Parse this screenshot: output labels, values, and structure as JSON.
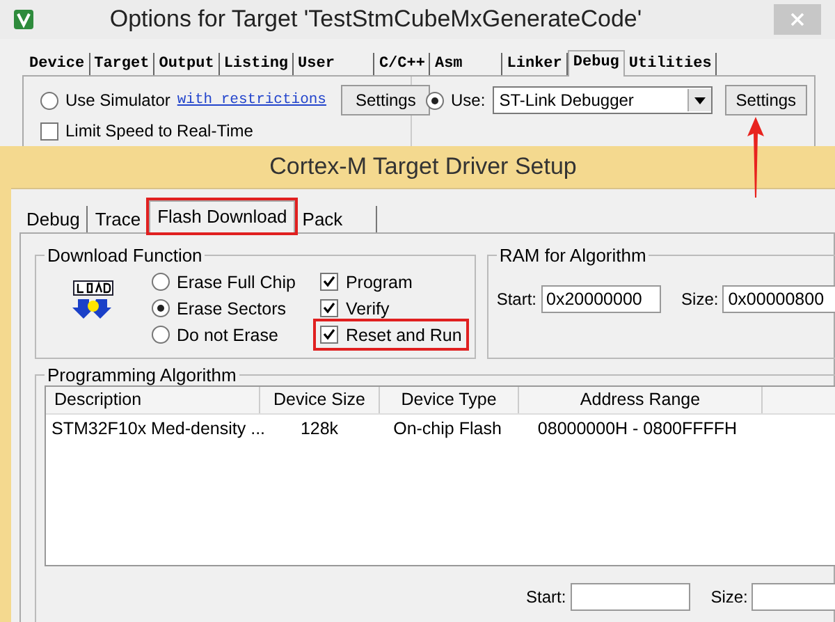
{
  "window": {
    "title": "Options for Target 'TestStmCubeMxGenerateCode'"
  },
  "tabs": [
    {
      "label": "Device",
      "selected": false
    },
    {
      "label": "Target",
      "selected": false
    },
    {
      "label": "Output",
      "selected": false
    },
    {
      "label": "Listing",
      "selected": false
    },
    {
      "label": "User",
      "selected": false
    },
    {
      "label": "C/C++",
      "selected": false
    },
    {
      "label": "Asm",
      "selected": false
    },
    {
      "label": "Linker",
      "selected": false
    },
    {
      "label": "Debug",
      "selected": true
    },
    {
      "label": "Utilities",
      "selected": false
    }
  ],
  "debug_panel": {
    "simulator": {
      "label": "Use Simulator",
      "selected": false
    },
    "restrictions_link": "with restrictions",
    "simulator_settings": "Settings",
    "limit_speed": {
      "label": "Limit Speed to Real-Time",
      "checked": false
    },
    "use": {
      "label": "Use:",
      "selected": true
    },
    "debugger": "ST-Link Debugger",
    "debugger_settings": "Settings"
  },
  "dialog": {
    "title": "Cortex-M Target Driver Setup",
    "tabs": [
      {
        "label": "Debug",
        "selected": false,
        "highlighted": false
      },
      {
        "label": "Trace",
        "selected": false,
        "highlighted": false
      },
      {
        "label": "Flash Download",
        "selected": true,
        "highlighted": true
      },
      {
        "label": "Pack",
        "selected": false,
        "highlighted": false
      }
    ],
    "download_function": {
      "title": "Download Function",
      "erase_options": [
        {
          "label": "Erase Full Chip",
          "selected": false
        },
        {
          "label": "Erase Sectors",
          "selected": true
        },
        {
          "label": "Do not Erase",
          "selected": false
        }
      ],
      "actions": [
        {
          "label": "Program",
          "checked": true,
          "highlighted": false
        },
        {
          "label": "Verify",
          "checked": true,
          "highlighted": false
        },
        {
          "label": "Reset and Run",
          "checked": true,
          "highlighted": true
        }
      ]
    },
    "ram": {
      "title": "RAM for Algorithm",
      "start_label": "Start:",
      "start": "0x20000000",
      "size_label": "Size:",
      "size": "0x00000800"
    },
    "programming": {
      "title": "Programming Algorithm",
      "columns": [
        "Description",
        "Device Size",
        "Device Type",
        "Address Range"
      ],
      "rows": [
        [
          "STM32F10x Med-density ...",
          "128k",
          "On-chip Flash",
          "08000000H - 0800FFFFH"
        ]
      ],
      "start_label": "Start:",
      "size_label": "Size:"
    }
  }
}
